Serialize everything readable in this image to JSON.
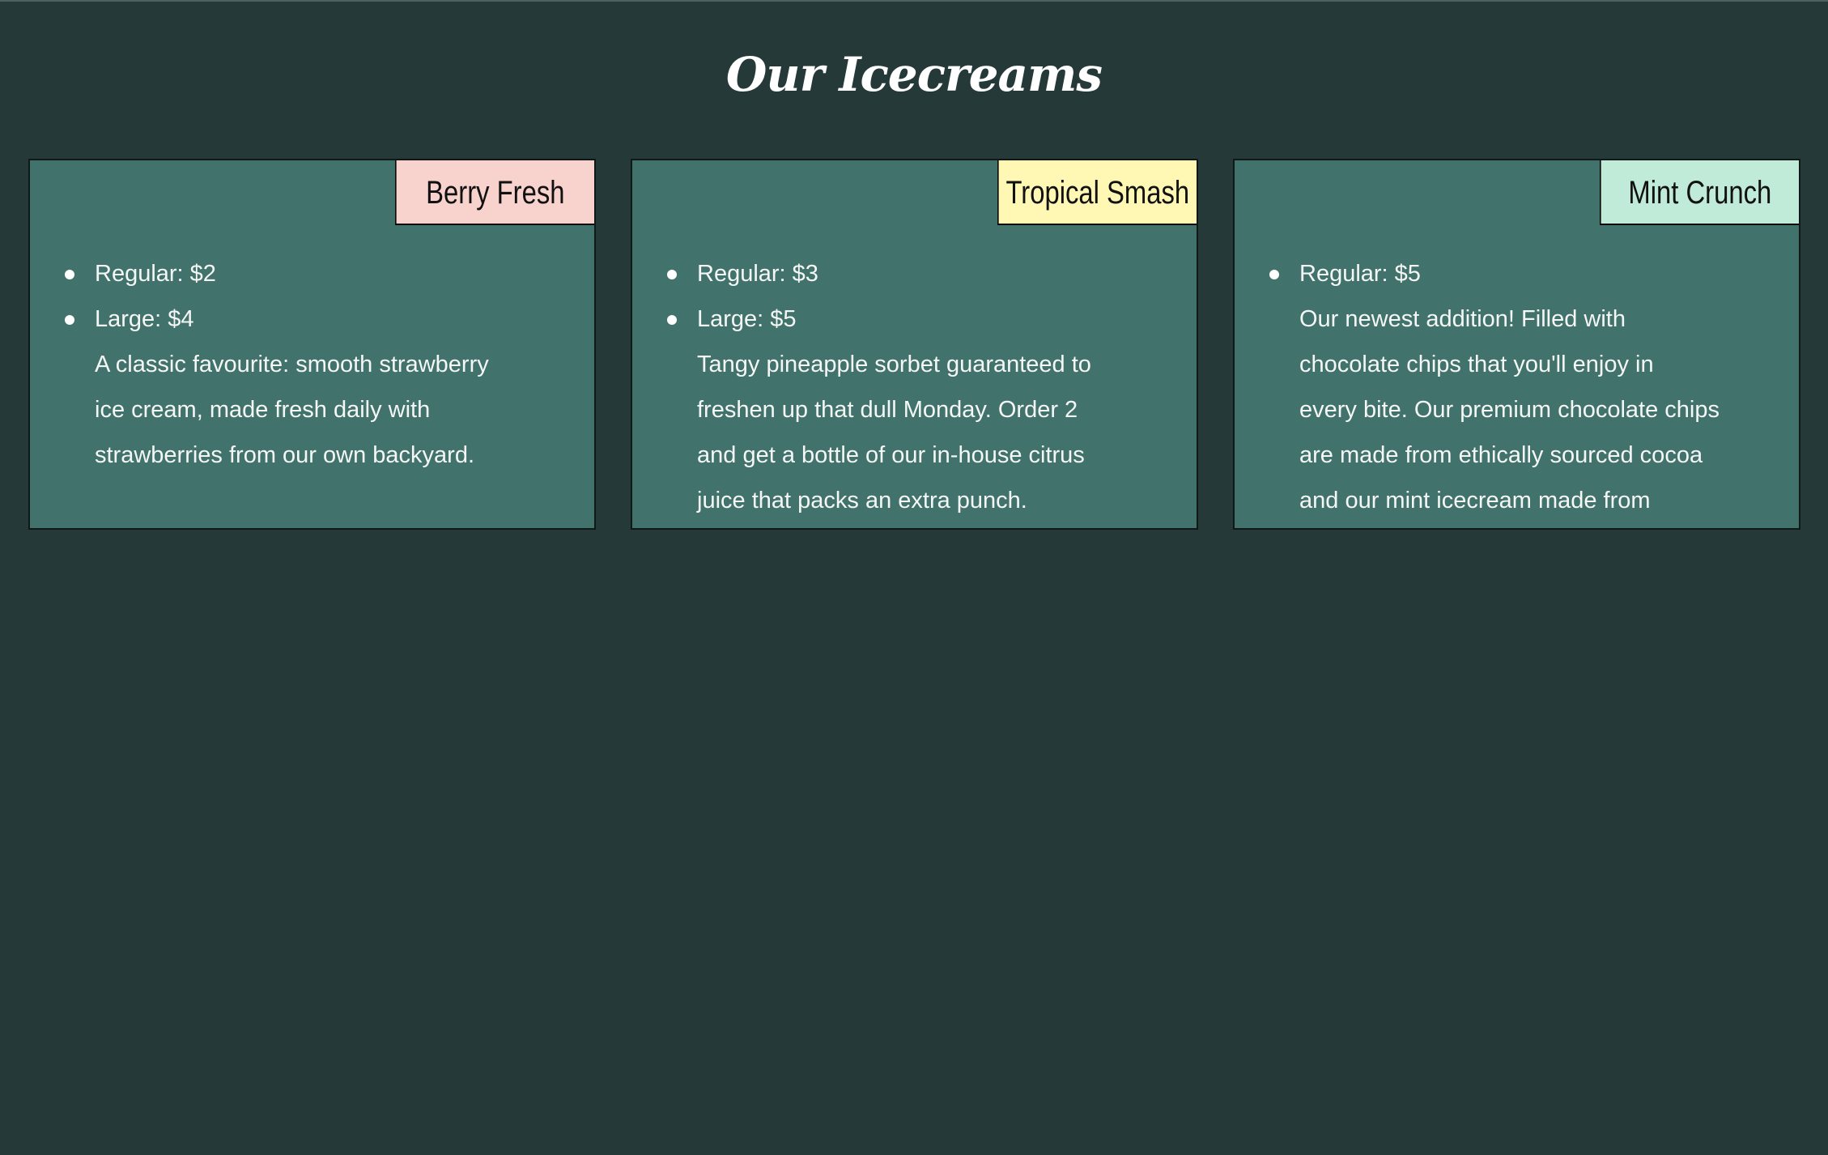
{
  "page": {
    "title": "Our Icecreams"
  },
  "cards": [
    {
      "name": "Berry Fresh",
      "tag_color": "#f8d3ce",
      "prices": [
        "Regular: $2",
        "Large: $4"
      ],
      "description_lines": [
        "A classic favourite: smooth strawberry",
        "ice cream, made fresh daily with",
        "strawberries from our own backyard."
      ]
    },
    {
      "name": "Tropical Smash",
      "tag_color": "#fff8b5",
      "prices": [
        "Regular: $3",
        "Large: $5"
      ],
      "description_lines": [
        "Tangy pineapple sorbet guaranteed to",
        "freshen up that dull Monday. Order 2",
        "and get a bottle of our in-house citrus",
        "juice that packs an extra punch."
      ]
    },
    {
      "name": "Mint Crunch",
      "tag_color": "#bfebd8",
      "prices": [
        "Regular: $5"
      ],
      "description_lines": [
        "Our newest addition! Filled with",
        "chocolate chips that you'll enjoy in",
        "every bite. Our premium chocolate chips",
        "are made from ethically sourced cocoa",
        "and our mint icecream made from"
      ]
    }
  ]
}
